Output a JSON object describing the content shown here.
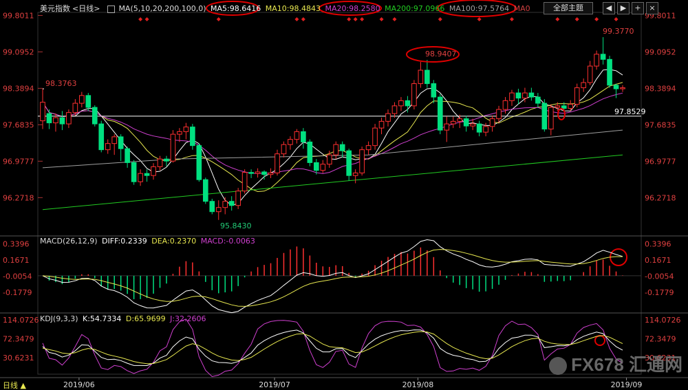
{
  "title_bar": {
    "name": "美元指数",
    "period": "<日线>",
    "buttons": {
      "main": "全部主题",
      "prev": "◀",
      "next": "▶",
      "add": "+",
      "close": "×"
    }
  },
  "price_header": {
    "ma_label": "MA(5,10,20,200,100,0)",
    "ma5": "MA5:98.6416",
    "ma10": "MA10:98.4843",
    "ma20": "MA20:98.2580",
    "ma200": "MA200:97.0966",
    "ma100": "MA100:97.5764",
    "ma0": "MA0"
  },
  "macd_header": {
    "label": "MACD(26,12,9)",
    "diff": "DIFF:0.2339",
    "dea": "DEA:0.2370",
    "macd": "MACD:-0.0063"
  },
  "kdj_header": {
    "label": "KDJ(9,3,3)",
    "k": "K:54.7334",
    "d": "D:65.9699",
    "j": "J:32.2606"
  },
  "bottom_bar": {
    "period": "日线 ▲"
  },
  "watermark": {
    "text": "FX678 汇通网"
  },
  "colors": {
    "up": "#ff3030",
    "down": "#00e080",
    "ma5": "#ffffff",
    "ma10": "#e8e850",
    "ma20": "#d040d0",
    "ma200": "#22cc22",
    "ma100": "#a0a0a0",
    "hline": "#ffffff",
    "highlight": "#e00000"
  },
  "chart_data": [
    {
      "type": "candlestick",
      "title": "美元指数 日线",
      "x_ticks": [
        "2019/06",
        "2019/07",
        "2019/08",
        "2019/09"
      ],
      "y_ticks": [
        "99.8011",
        "99.0952",
        "98.3894",
        "97.6835",
        "96.9777",
        "96.2718"
      ],
      "ylim": [
        95.57,
        99.86
      ],
      "annotations": {
        "high_jun": "98.3763",
        "low_jul": "95.8430",
        "high_aug": "98.9407",
        "high_sep": "99.3770",
        "last": "97.8529"
      },
      "horizontal_line": 97.85,
      "candles": [
        [
          97.76,
          98.12,
          97.6,
          98.38
        ],
        [
          97.9,
          97.72,
          97.6,
          97.98
        ],
        [
          97.72,
          97.82,
          97.55,
          97.9
        ],
        [
          97.82,
          97.7,
          97.58,
          97.95
        ],
        [
          97.7,
          97.92,
          97.62,
          97.98
        ],
        [
          97.92,
          98.1,
          97.86,
          98.18
        ],
        [
          98.1,
          98.25,
          98.02,
          98.32
        ],
        [
          98.25,
          98.02,
          97.95,
          98.3
        ],
        [
          98.02,
          97.7,
          97.65,
          98.06
        ],
        [
          97.7,
          97.2,
          97.15,
          97.76
        ],
        [
          97.2,
          97.32,
          97.12,
          97.4
        ],
        [
          97.32,
          97.45,
          97.1,
          97.5
        ],
        [
          97.45,
          97.22,
          96.98,
          97.5
        ],
        [
          97.22,
          96.95,
          96.85,
          97.26
        ],
        [
          96.95,
          96.58,
          96.52,
          97.0
        ],
        [
          96.58,
          96.74,
          96.5,
          96.82
        ],
        [
          96.74,
          96.7,
          96.58,
          96.82
        ],
        [
          96.7,
          96.87,
          96.62,
          96.94
        ],
        [
          96.87,
          97.02,
          96.8,
          97.08
        ],
        [
          97.02,
          96.98,
          96.88,
          97.08
        ],
        [
          96.98,
          97.5,
          96.95,
          97.58
        ],
        [
          97.5,
          97.55,
          97.35,
          97.62
        ],
        [
          97.55,
          97.64,
          97.4,
          97.72
        ],
        [
          97.64,
          97.28,
          97.2,
          97.7
        ],
        [
          97.28,
          96.62,
          96.58,
          97.32
        ],
        [
          96.62,
          96.2,
          96.15,
          96.66
        ],
        [
          96.2,
          96.0,
          95.95,
          96.25
        ],
        [
          96.0,
          96.08,
          95.84,
          96.22
        ],
        [
          96.08,
          96.2,
          95.95,
          96.28
        ],
        [
          96.2,
          96.12,
          96.02,
          96.3
        ],
        [
          96.12,
          96.4,
          96.05,
          96.46
        ],
        [
          96.4,
          96.76,
          96.35,
          96.82
        ],
        [
          96.76,
          96.74,
          96.65,
          96.82
        ],
        [
          96.74,
          96.77,
          96.66,
          96.84
        ],
        [
          96.77,
          96.72,
          96.62,
          96.8
        ],
        [
          96.72,
          96.75,
          96.65,
          96.84
        ],
        [
          96.75,
          97.12,
          96.7,
          97.2
        ],
        [
          97.12,
          97.3,
          97.05,
          97.36
        ],
        [
          97.3,
          97.4,
          97.2,
          97.46
        ],
        [
          97.4,
          97.55,
          97.32,
          97.6
        ],
        [
          97.55,
          97.35,
          97.22,
          97.62
        ],
        [
          97.35,
          96.95,
          96.88,
          97.4
        ],
        [
          96.95,
          96.8,
          96.72,
          97.02
        ],
        [
          96.8,
          96.92,
          96.75,
          97.0
        ],
        [
          96.92,
          97.1,
          96.85,
          97.18
        ],
        [
          97.1,
          97.3,
          97.02,
          97.36
        ],
        [
          97.3,
          97.18,
          97.05,
          97.36
        ],
        [
          97.18,
          96.7,
          96.6,
          97.22
        ],
        [
          96.7,
          96.75,
          96.55,
          96.82
        ],
        [
          96.75,
          97.2,
          96.7,
          97.26
        ],
        [
          97.2,
          97.28,
          97.1,
          97.36
        ],
        [
          97.28,
          97.62,
          97.2,
          97.7
        ],
        [
          97.62,
          97.75,
          97.5,
          97.82
        ],
        [
          97.75,
          97.9,
          97.65,
          97.98
        ],
        [
          97.9,
          98.05,
          97.82,
          98.12
        ],
        [
          98.05,
          98.15,
          97.95,
          98.22
        ],
        [
          98.15,
          98.05,
          97.92,
          98.24
        ],
        [
          98.05,
          98.48,
          97.98,
          98.55
        ],
        [
          98.48,
          98.74,
          98.4,
          98.9
        ],
        [
          98.74,
          98.48,
          98.4,
          98.94
        ],
        [
          98.48,
          98.22,
          98.1,
          98.55
        ],
        [
          98.22,
          97.58,
          97.5,
          98.28
        ],
        [
          97.58,
          97.7,
          97.35,
          97.84
        ],
        [
          97.7,
          97.75,
          97.62,
          97.84
        ],
        [
          97.75,
          97.8,
          97.62,
          97.88
        ],
        [
          97.8,
          97.66,
          97.55,
          97.86
        ],
        [
          97.66,
          97.7,
          97.58,
          97.8
        ],
        [
          97.7,
          97.54,
          97.46,
          97.76
        ],
        [
          97.54,
          97.65,
          97.46,
          97.72
        ],
        [
          97.65,
          97.8,
          97.55,
          97.86
        ],
        [
          97.8,
          97.98,
          97.72,
          98.05
        ],
        [
          97.98,
          98.15,
          97.9,
          98.22
        ],
        [
          98.15,
          98.3,
          98.05,
          98.36
        ],
        [
          98.3,
          98.2,
          98.08,
          98.38
        ],
        [
          98.2,
          98.3,
          98.12,
          98.4
        ],
        [
          98.3,
          98.22,
          98.15,
          98.4
        ],
        [
          98.22,
          98.1,
          98.02,
          98.3
        ],
        [
          98.1,
          97.6,
          97.55,
          98.18
        ],
        [
          97.6,
          98.02,
          97.48,
          98.08
        ],
        [
          98.02,
          98.05,
          97.95,
          98.12
        ],
        [
          98.05,
          98.0,
          97.96,
          98.12
        ],
        [
          98.0,
          98.08,
          97.95,
          98.16
        ],
        [
          98.08,
          98.4,
          98.02,
          98.48
        ],
        [
          98.4,
          98.5,
          98.32,
          98.58
        ],
        [
          98.5,
          98.82,
          98.45,
          98.92
        ],
        [
          98.82,
          99.05,
          98.75,
          99.12
        ],
        [
          99.05,
          98.95,
          98.85,
          99.38
        ],
        [
          98.95,
          98.45,
          98.4,
          99.02
        ],
        [
          98.45,
          98.38,
          98.2,
          98.48
        ],
        [
          98.38,
          98.4,
          98.32,
          98.45
        ]
      ],
      "series": [
        {
          "name": "MA5",
          "values": []
        },
        {
          "name": "MA10",
          "values": []
        },
        {
          "name": "MA20",
          "values": []
        },
        {
          "name": "MA200",
          "values": []
        },
        {
          "name": "MA100",
          "values": []
        }
      ]
    },
    {
      "type": "bar",
      "title": "MACD(26,12,9)",
      "y_ticks": [
        "0.3396",
        "0.1671",
        "-0.0054",
        "-0.1779"
      ],
      "ylim": [
        -0.36,
        0.41
      ]
    },
    {
      "type": "line",
      "title": "KDJ(9,3,3)",
      "y_ticks": [
        "114.0726",
        "72.3479",
        "30.6231"
      ],
      "ylim": [
        -12,
        125
      ]
    }
  ]
}
